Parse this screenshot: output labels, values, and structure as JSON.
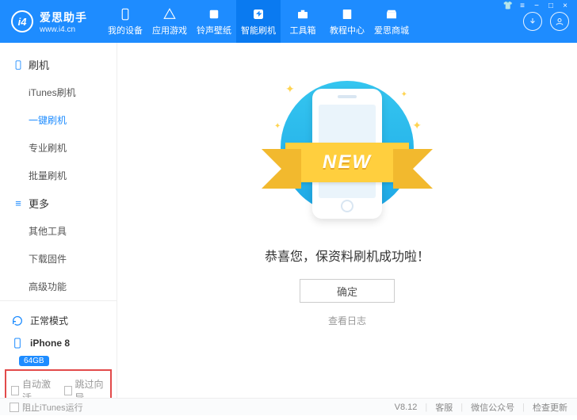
{
  "brand": {
    "name": "爱思助手",
    "site": "www.i4.cn",
    "logo": "i4"
  },
  "nav": [
    {
      "label": "我的设备",
      "icon": "device"
    },
    {
      "label": "应用游戏",
      "icon": "apps"
    },
    {
      "label": "铃声壁纸",
      "icon": "music"
    },
    {
      "label": "智能刷机",
      "icon": "flash",
      "active": true
    },
    {
      "label": "工具箱",
      "icon": "tools"
    },
    {
      "label": "教程中心",
      "icon": "book"
    },
    {
      "label": "爱思商城",
      "icon": "store"
    }
  ],
  "sidebar": {
    "sections": [
      {
        "title": "刷机",
        "icon": "phone-icon",
        "items": [
          {
            "label": "iTunes刷机"
          },
          {
            "label": "一键刷机",
            "active": true
          },
          {
            "label": "专业刷机"
          },
          {
            "label": "批量刷机"
          }
        ]
      },
      {
        "title": "更多",
        "icon": "list-icon",
        "items": [
          {
            "label": "其他工具"
          },
          {
            "label": "下载固件"
          },
          {
            "label": "高级功能"
          }
        ]
      }
    ],
    "mode": "正常模式",
    "device": "iPhone 8",
    "storage": "64GB",
    "options": {
      "auto_activate": "自动激活",
      "skip_setup": "跳过向导"
    }
  },
  "main": {
    "ribbon": "NEW",
    "message": "恭喜您，保资料刷机成功啦！",
    "ok": "确定",
    "log": "查看日志"
  },
  "status": {
    "block_itunes": "阻止iTunes运行",
    "version": "V8.12",
    "support": "客服",
    "wechat": "微信公众号",
    "update": "检查更新"
  }
}
